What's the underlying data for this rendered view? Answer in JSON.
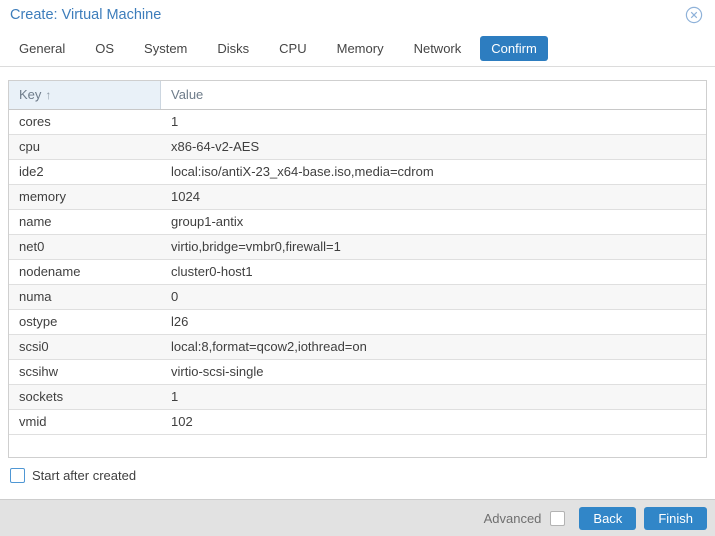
{
  "window": {
    "title": "Create: Virtual Machine"
  },
  "tabs": [
    {
      "label": "General",
      "active": false
    },
    {
      "label": "OS",
      "active": false
    },
    {
      "label": "System",
      "active": false
    },
    {
      "label": "Disks",
      "active": false
    },
    {
      "label": "CPU",
      "active": false
    },
    {
      "label": "Memory",
      "active": false
    },
    {
      "label": "Network",
      "active": false
    },
    {
      "label": "Confirm",
      "active": true
    }
  ],
  "table": {
    "columns": {
      "key_label": "Key",
      "value_label": "Value",
      "sort_arrow": "↑",
      "sorted_column": "Key",
      "sort_direction": "ascending"
    },
    "rows": [
      {
        "key": "cores",
        "value": "1"
      },
      {
        "key": "cpu",
        "value": "x86-64-v2-AES"
      },
      {
        "key": "ide2",
        "value": "local:iso/antiX-23_x64-base.iso,media=cdrom"
      },
      {
        "key": "memory",
        "value": "1024"
      },
      {
        "key": "name",
        "value": "group1-antix"
      },
      {
        "key": "net0",
        "value": "virtio,bridge=vmbr0,firewall=1"
      },
      {
        "key": "nodename",
        "value": "cluster0-host1"
      },
      {
        "key": "numa",
        "value": "0"
      },
      {
        "key": "ostype",
        "value": "l26"
      },
      {
        "key": "scsi0",
        "value": "local:8,format=qcow2,iothread=on"
      },
      {
        "key": "scsihw",
        "value": "virtio-scsi-single"
      },
      {
        "key": "sockets",
        "value": "1"
      },
      {
        "key": "vmid",
        "value": "102"
      }
    ]
  },
  "options": {
    "start_after_created_label": "Start after created",
    "start_after_created_checked": false
  },
  "footer": {
    "advanced_label": "Advanced",
    "advanced_checked": false,
    "back_label": "Back",
    "finish_label": "Finish"
  },
  "colors": {
    "accent_blue": "#2d7dc0",
    "title_blue": "#3d7dbb",
    "button_blue": "#3186c8",
    "header_cell_bg": "#e9f1f8",
    "row_alt_bg": "#f7f7f7",
    "footer_bg": "#e2e2e2",
    "checkbox_blue_border": "#4f97d4"
  }
}
